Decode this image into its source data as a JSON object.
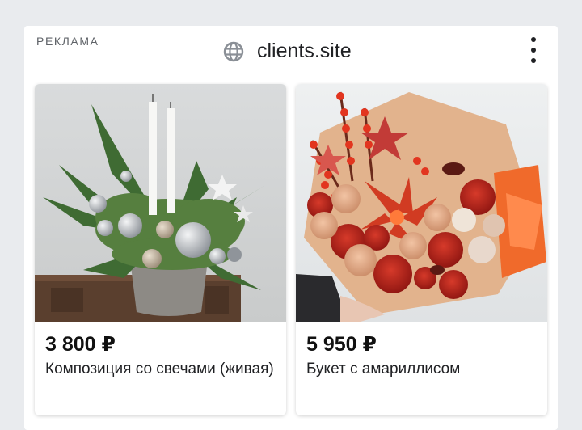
{
  "ad": {
    "label": "РЕКЛАМА",
    "domain": "clients.site",
    "globe_icon": "globe-icon",
    "menu_icon": "more-vertical-icon"
  },
  "products": [
    {
      "price": "3 800 ₽",
      "name": "Композиция со свечами (живая)",
      "image": "photo-christmas-candle-arrangement"
    },
    {
      "price": "5 950 ₽",
      "name": "Букет с амариллисом",
      "image": "photo-red-amaryllis-bouquet"
    }
  ],
  "colors": {
    "page_bg": "#e9ebee",
    "card_bg": "#ffffff",
    "text": "#202124"
  }
}
